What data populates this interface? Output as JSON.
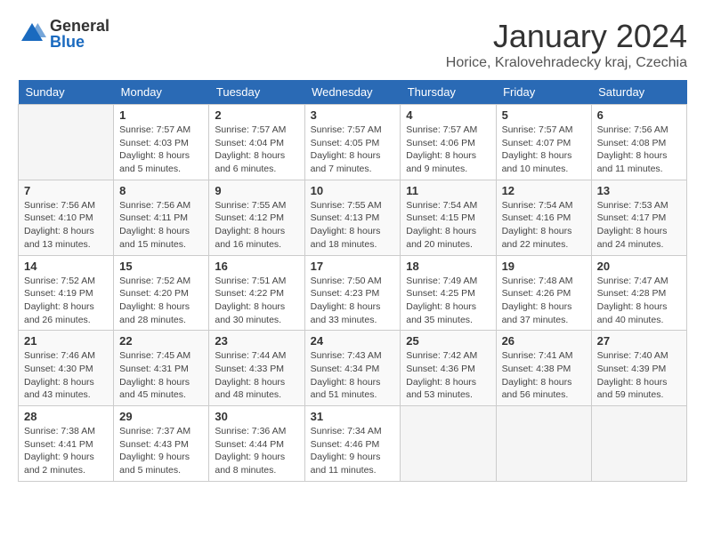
{
  "header": {
    "logo": {
      "general": "General",
      "blue": "Blue"
    },
    "title": "January 2024",
    "location": "Horice, Kralovehradecky kraj, Czechia"
  },
  "calendar": {
    "days_of_week": [
      "Sunday",
      "Monday",
      "Tuesday",
      "Wednesday",
      "Thursday",
      "Friday",
      "Saturday"
    ],
    "weeks": [
      [
        {
          "day": "",
          "info": ""
        },
        {
          "day": "1",
          "info": "Sunrise: 7:57 AM\nSunset: 4:03 PM\nDaylight: 8 hours\nand 5 minutes."
        },
        {
          "day": "2",
          "info": "Sunrise: 7:57 AM\nSunset: 4:04 PM\nDaylight: 8 hours\nand 6 minutes."
        },
        {
          "day": "3",
          "info": "Sunrise: 7:57 AM\nSunset: 4:05 PM\nDaylight: 8 hours\nand 7 minutes."
        },
        {
          "day": "4",
          "info": "Sunrise: 7:57 AM\nSunset: 4:06 PM\nDaylight: 8 hours\nand 9 minutes."
        },
        {
          "day": "5",
          "info": "Sunrise: 7:57 AM\nSunset: 4:07 PM\nDaylight: 8 hours\nand 10 minutes."
        },
        {
          "day": "6",
          "info": "Sunrise: 7:56 AM\nSunset: 4:08 PM\nDaylight: 8 hours\nand 11 minutes."
        }
      ],
      [
        {
          "day": "7",
          "info": "Sunrise: 7:56 AM\nSunset: 4:10 PM\nDaylight: 8 hours\nand 13 minutes."
        },
        {
          "day": "8",
          "info": "Sunrise: 7:56 AM\nSunset: 4:11 PM\nDaylight: 8 hours\nand 15 minutes."
        },
        {
          "day": "9",
          "info": "Sunrise: 7:55 AM\nSunset: 4:12 PM\nDaylight: 8 hours\nand 16 minutes."
        },
        {
          "day": "10",
          "info": "Sunrise: 7:55 AM\nSunset: 4:13 PM\nDaylight: 8 hours\nand 18 minutes."
        },
        {
          "day": "11",
          "info": "Sunrise: 7:54 AM\nSunset: 4:15 PM\nDaylight: 8 hours\nand 20 minutes."
        },
        {
          "day": "12",
          "info": "Sunrise: 7:54 AM\nSunset: 4:16 PM\nDaylight: 8 hours\nand 22 minutes."
        },
        {
          "day": "13",
          "info": "Sunrise: 7:53 AM\nSunset: 4:17 PM\nDaylight: 8 hours\nand 24 minutes."
        }
      ],
      [
        {
          "day": "14",
          "info": "Sunrise: 7:52 AM\nSunset: 4:19 PM\nDaylight: 8 hours\nand 26 minutes."
        },
        {
          "day": "15",
          "info": "Sunrise: 7:52 AM\nSunset: 4:20 PM\nDaylight: 8 hours\nand 28 minutes."
        },
        {
          "day": "16",
          "info": "Sunrise: 7:51 AM\nSunset: 4:22 PM\nDaylight: 8 hours\nand 30 minutes."
        },
        {
          "day": "17",
          "info": "Sunrise: 7:50 AM\nSunset: 4:23 PM\nDaylight: 8 hours\nand 33 minutes."
        },
        {
          "day": "18",
          "info": "Sunrise: 7:49 AM\nSunset: 4:25 PM\nDaylight: 8 hours\nand 35 minutes."
        },
        {
          "day": "19",
          "info": "Sunrise: 7:48 AM\nSunset: 4:26 PM\nDaylight: 8 hours\nand 37 minutes."
        },
        {
          "day": "20",
          "info": "Sunrise: 7:47 AM\nSunset: 4:28 PM\nDaylight: 8 hours\nand 40 minutes."
        }
      ],
      [
        {
          "day": "21",
          "info": "Sunrise: 7:46 AM\nSunset: 4:30 PM\nDaylight: 8 hours\nand 43 minutes."
        },
        {
          "day": "22",
          "info": "Sunrise: 7:45 AM\nSunset: 4:31 PM\nDaylight: 8 hours\nand 45 minutes."
        },
        {
          "day": "23",
          "info": "Sunrise: 7:44 AM\nSunset: 4:33 PM\nDaylight: 8 hours\nand 48 minutes."
        },
        {
          "day": "24",
          "info": "Sunrise: 7:43 AM\nSunset: 4:34 PM\nDaylight: 8 hours\nand 51 minutes."
        },
        {
          "day": "25",
          "info": "Sunrise: 7:42 AM\nSunset: 4:36 PM\nDaylight: 8 hours\nand 53 minutes."
        },
        {
          "day": "26",
          "info": "Sunrise: 7:41 AM\nSunset: 4:38 PM\nDaylight: 8 hours\nand 56 minutes."
        },
        {
          "day": "27",
          "info": "Sunrise: 7:40 AM\nSunset: 4:39 PM\nDaylight: 8 hours\nand 59 minutes."
        }
      ],
      [
        {
          "day": "28",
          "info": "Sunrise: 7:38 AM\nSunset: 4:41 PM\nDaylight: 9 hours\nand 2 minutes."
        },
        {
          "day": "29",
          "info": "Sunrise: 7:37 AM\nSunset: 4:43 PM\nDaylight: 9 hours\nand 5 minutes."
        },
        {
          "day": "30",
          "info": "Sunrise: 7:36 AM\nSunset: 4:44 PM\nDaylight: 9 hours\nand 8 minutes."
        },
        {
          "day": "31",
          "info": "Sunrise: 7:34 AM\nSunset: 4:46 PM\nDaylight: 9 hours\nand 11 minutes."
        },
        {
          "day": "",
          "info": ""
        },
        {
          "day": "",
          "info": ""
        },
        {
          "day": "",
          "info": ""
        }
      ]
    ]
  }
}
